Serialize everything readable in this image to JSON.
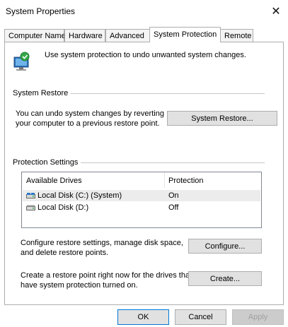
{
  "window": {
    "title": "System Properties",
    "close_glyph": "✕"
  },
  "tabs": [
    {
      "label": "Computer Name"
    },
    {
      "label": "Hardware"
    },
    {
      "label": "Advanced"
    },
    {
      "label": "System Protection",
      "active": true
    },
    {
      "label": "Remote"
    }
  ],
  "intro": {
    "icon": "system-protection-shield-icon",
    "text": "Use system protection to undo unwanted system changes."
  },
  "system_restore": {
    "heading": "System Restore",
    "description_line1": "You can undo system changes by reverting",
    "description_line2": "your computer to a previous restore point.",
    "button_label": "System Restore..."
  },
  "protection": {
    "heading": "Protection Settings",
    "columns": [
      "Available Drives",
      "Protection"
    ],
    "drives": [
      {
        "name": "Local Disk (C:) (System)",
        "protection": "On",
        "icon": "system-drive-icon",
        "selected": true
      },
      {
        "name": "Local Disk (D:)",
        "protection": "Off",
        "icon": "disk-drive-icon",
        "selected": false
      }
    ],
    "configure_line1": "Configure restore settings, manage disk space,",
    "configure_line2": "and delete restore points.",
    "configure_label": "Configure...",
    "create_line1": "Create a restore point right now for the drives that",
    "create_line2": "have system protection turned on.",
    "create_label": "Create..."
  },
  "footer": {
    "ok_label": "OK",
    "cancel_label": "Cancel",
    "apply_label": "Apply"
  },
  "colors": {
    "accent": "#0078d7",
    "border": "#adadad",
    "button_bg": "#e1e1e1"
  }
}
